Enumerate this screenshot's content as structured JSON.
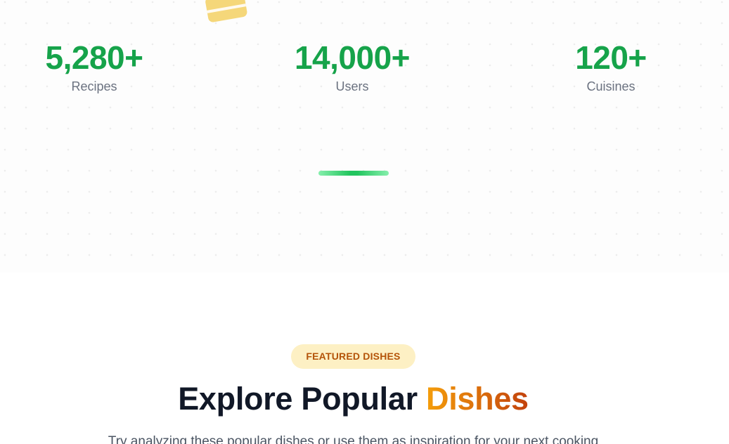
{
  "stats": [
    {
      "value": "5,280+",
      "label": "Recipes"
    },
    {
      "value": "14,000+",
      "label": "Users"
    },
    {
      "value": "120+",
      "label": "Cuisines"
    }
  ],
  "decor": {
    "cheese_icon": "cheese-icon",
    "cheese_color": "#f5d77a"
  },
  "colors": {
    "accent_green": "#16a34a",
    "badge_bg": "#fdf0c4",
    "badge_text": "#b45309",
    "heading_dark": "#111827"
  },
  "featured": {
    "badge": "FEATURED DISHES",
    "heading_main": "Explore Popular ",
    "heading_accent": "Dishes",
    "subtext": "Try analyzing these popular dishes or use them as inspiration for your next cooking"
  }
}
